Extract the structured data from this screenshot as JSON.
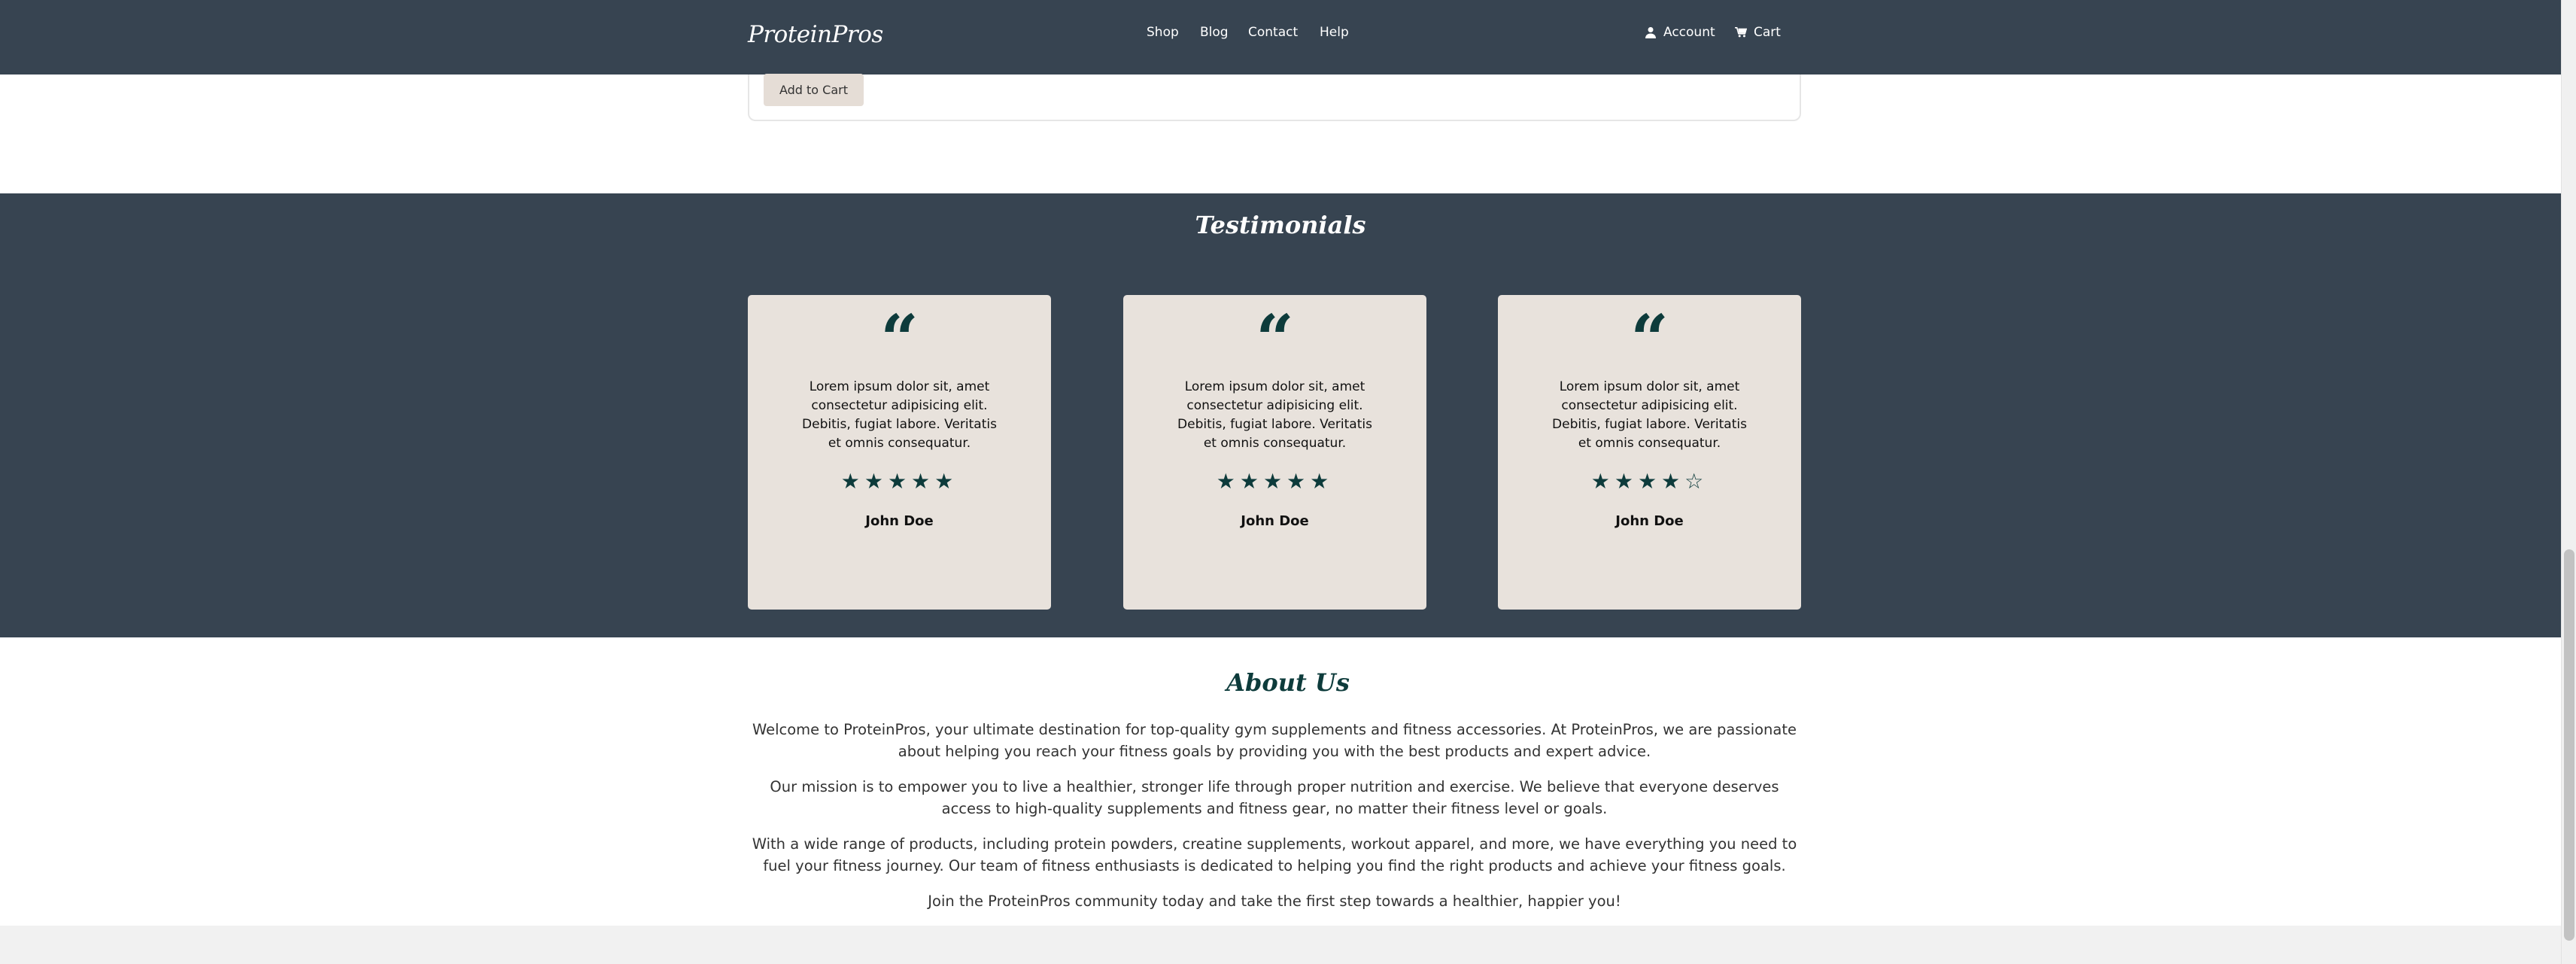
{
  "navbar": {
    "brand": "ProteinPros",
    "links": [
      "Shop",
      "Blog",
      "Contact",
      "Help"
    ],
    "account_label": "Account",
    "cart_label": "Cart",
    "account_icon": "user-icon",
    "cart_icon": "cart-icon"
  },
  "product": {
    "add_to_cart_label": "Add to Cart"
  },
  "testimonials": {
    "title": "Testimonials",
    "items": [
      {
        "quote_mark": "“",
        "text": "Lorem ipsum dolor sit, amet consectetur adipisicing elit. Debitis, fugiat labore. Veritatis et omnis consequatur.",
        "rating": 5,
        "stars": "★★★★★",
        "name": "John Doe"
      },
      {
        "quote_mark": "“",
        "text": "Lorem ipsum dolor sit, amet consectetur adipisicing elit. Debitis, fugiat labore. Veritatis et omnis consequatur.",
        "rating": 5,
        "stars": "★★★★★",
        "name": "John Doe"
      },
      {
        "quote_mark": "“",
        "text": "Lorem ipsum dolor sit, amet consectetur adipisicing elit. Debitis, fugiat labore. Veritatis et omnis consequatur.",
        "rating": 4,
        "stars": "★★★★☆",
        "name": "John Doe"
      }
    ]
  },
  "about": {
    "title": "About Us",
    "paragraphs": [
      "Welcome to ProteinPros, your ultimate destination for top-quality gym supplements and fitness accessories. At ProteinPros, we are passionate about helping you reach your fitness goals by providing you with the best products and expert advice.",
      "Our mission is to empower you to live a healthier, stronger life through proper nutrition and exercise. We believe that everyone deserves access to high-quality supplements and fitness gear, no matter their fitness level or goals.",
      "With a wide range of products, including protein powders, creatine supplements, workout apparel, and more, we have everything you need to fuel your fitness journey. Our team of fitness enthusiasts is dedicated to helping you find the right products and achieve your fitness goals.",
      "Join the ProteinPros community today and take the first step towards a healthier, happier you!"
    ]
  },
  "colors": {
    "dark": "#374451",
    "card": "#e8e2dc",
    "accent": "#0d3b3b"
  }
}
